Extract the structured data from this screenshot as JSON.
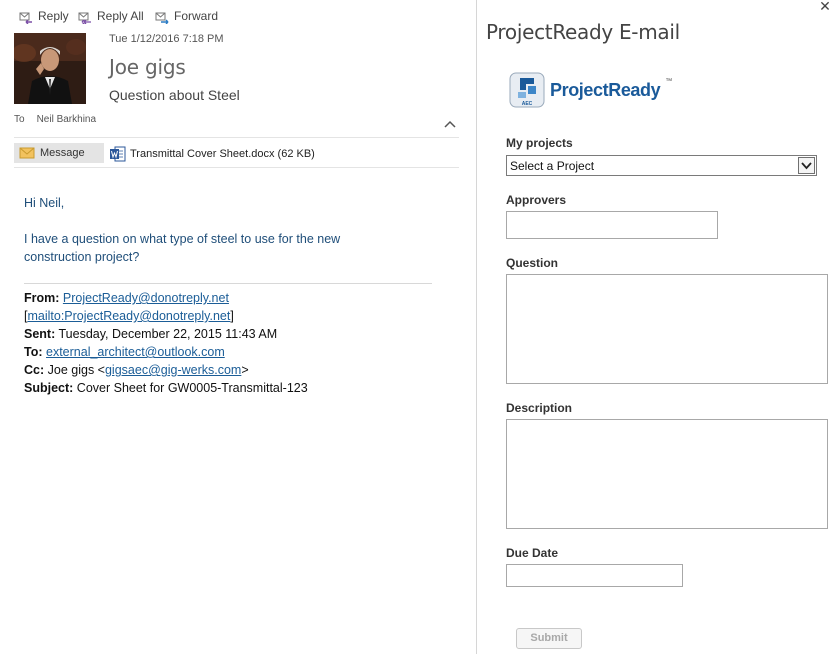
{
  "toolbar": {
    "reply_label": "Reply",
    "reply_all_label": "Reply All",
    "forward_label": "Forward"
  },
  "email": {
    "date": "Tue 1/12/2016 7:18 PM",
    "sender": "Joe gigs",
    "subject": "Question about Steel",
    "to_prefix": "To",
    "to_name": "Neil Barkhina",
    "message_tab_label": "Message",
    "attachment_name": "Transmittal Cover Sheet.docx (62 KB)",
    "greeting": "Hi Neil,",
    "body": "I have a question on what type of steel to use for the new construction project?",
    "forwarded": {
      "from_label": "From:",
      "from_email": "ProjectReady@donotreply.net",
      "mailto_open": "[",
      "mailto_link": "mailto:ProjectReady@donotreply.net",
      "mailto_close": "]",
      "sent_label": "Sent:",
      "sent_value": "Tuesday, December 22, 2015 11:43 AM",
      "to_label": "To:",
      "to_email": "external_architect@outlook.com",
      "cc_label": "Cc:",
      "cc_name": "Joe gigs <",
      "cc_email": "gigsaec@gig-werks.com",
      "cc_close": ">",
      "subject_label": "Subject:",
      "subject_value": "Cover Sheet for GW0005-Transmittal-123"
    }
  },
  "addin": {
    "close_glyph": "✕",
    "title": "ProjectReady E-mail",
    "logo_badge": "AEC",
    "logo_text": "ProjectReady",
    "logo_tm": "™",
    "my_projects_label": "My projects",
    "project_select_value": "Select a Project",
    "approvers_label": "Approvers",
    "question_label": "Question",
    "description_label": "Description",
    "due_date_label": "Due Date",
    "submit_label": "Submit"
  },
  "colors": {
    "body_text": "#1f4e79",
    "link": "#1b5d97",
    "logo_blue": "#1a5a9a"
  }
}
